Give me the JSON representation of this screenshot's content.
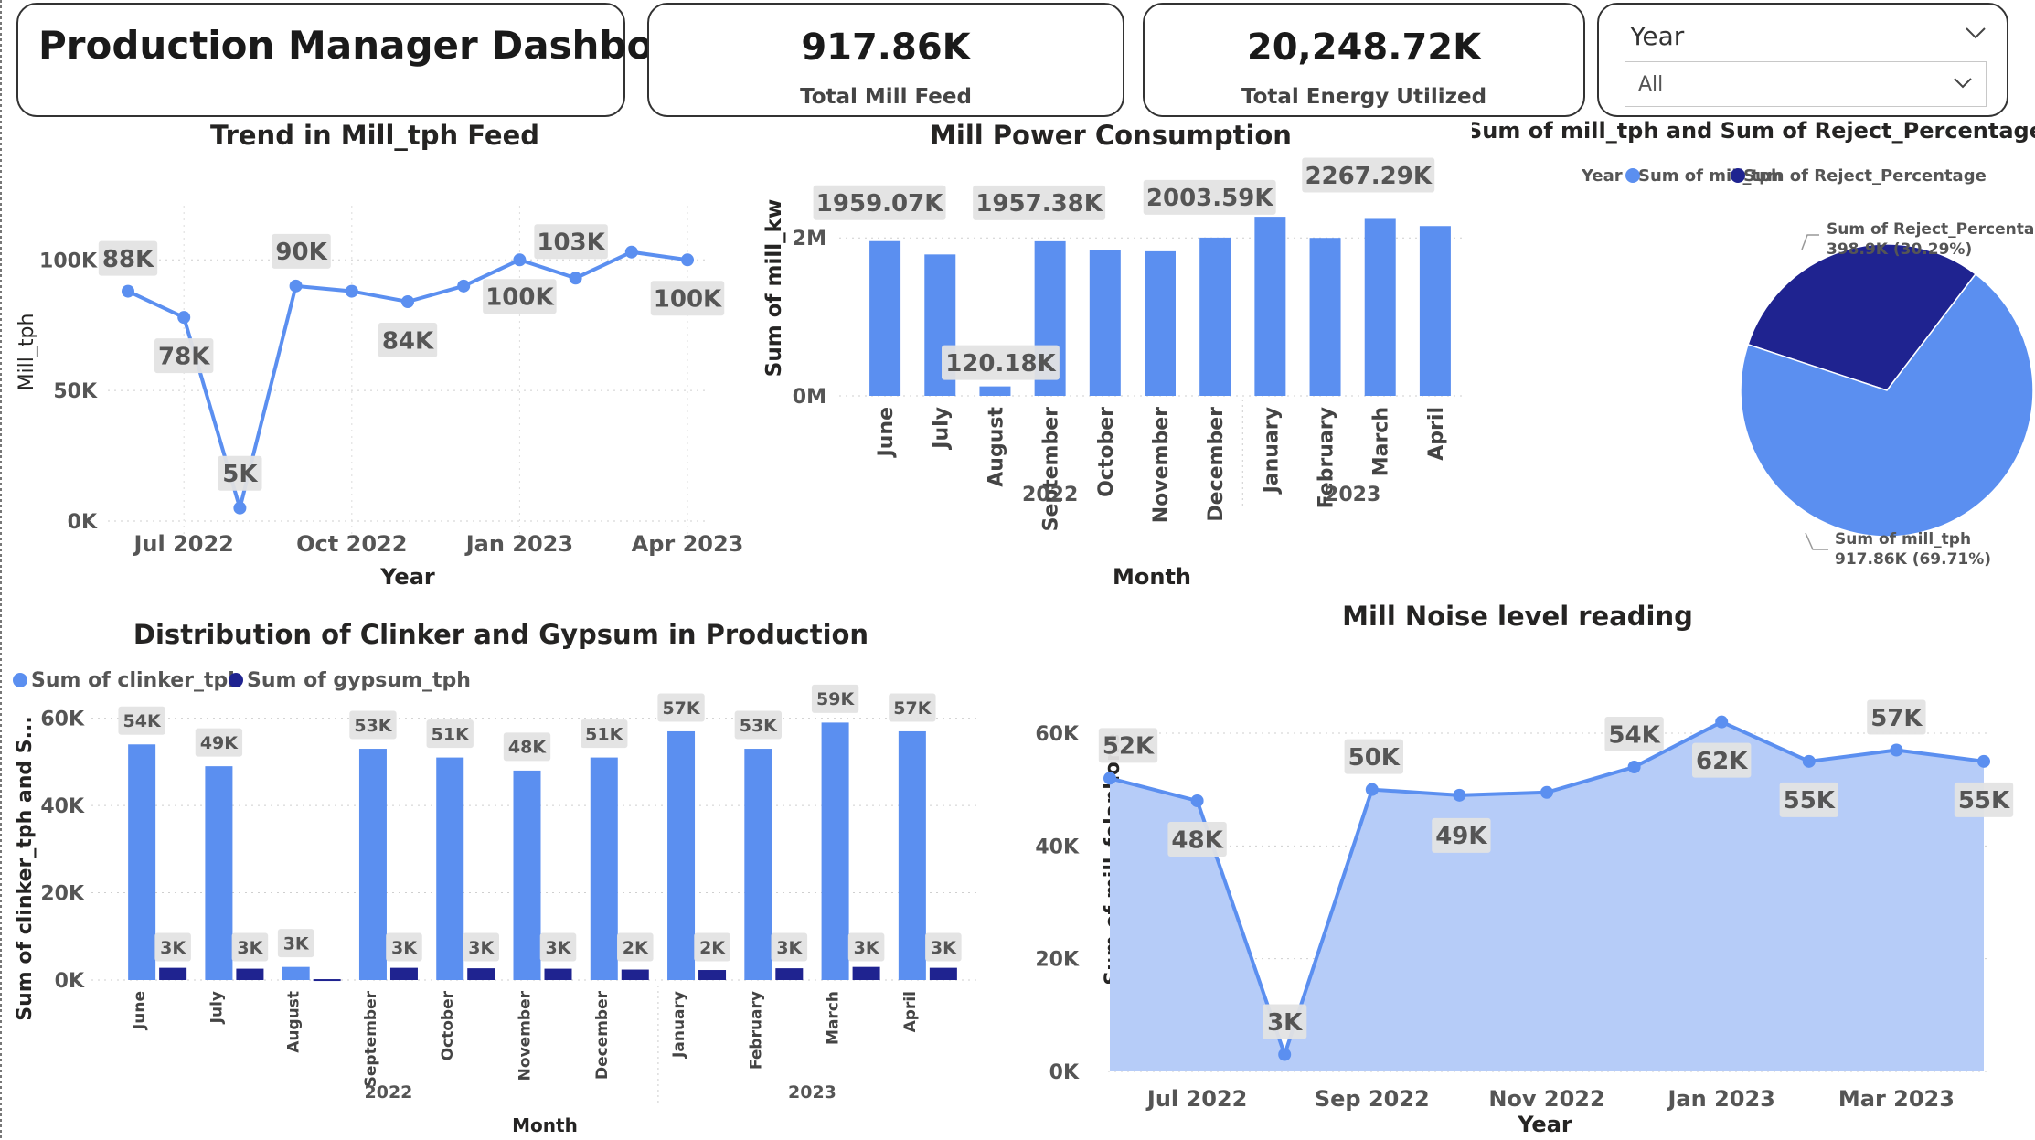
{
  "header": {
    "title": "Production Manager Dashboard",
    "kpis": [
      {
        "value": "917.86K",
        "label": "Total Mill Feed"
      },
      {
        "value": "20,248.72K",
        "label": "Total Energy Utilized"
      }
    ],
    "slicer": {
      "label": "Year",
      "selected": "All"
    }
  },
  "colors": {
    "primary": "#5b8ff0",
    "secondary": "#1f2390",
    "area": "#b6ccf8",
    "label_bg": "#e3e3e3"
  },
  "chart_data": [
    {
      "id": "trend",
      "type": "line",
      "title": "Trend in Mill_tph Feed",
      "xlabel": "Year",
      "ylabel": "Mill_tph",
      "x": [
        "2022-06",
        "2022-07",
        "2022-08",
        "2022-09",
        "2022-10",
        "2022-11",
        "2022-12",
        "2023-01",
        "2023-02",
        "2023-03",
        "2023-04"
      ],
      "values": [
        88,
        78,
        5,
        90,
        88,
        84,
        90,
        100,
        93,
        103,
        100
      ],
      "data_labels": [
        "88K",
        "78K",
        "5K",
        "90K",
        "",
        "84K",
        "",
        "100K",
        "103K",
        "",
        "100K"
      ],
      "x_ticks": [
        "Jul 2022",
        "Oct 2022",
        "Jan 2023",
        "Apr 2023"
      ],
      "y_ticks": [
        "0K",
        "50K",
        "100K"
      ],
      "ylim": [
        0,
        112
      ],
      "unit": "K"
    },
    {
      "id": "power",
      "type": "bar",
      "title": "Mill Power Consumption",
      "xlabel": "Month",
      "ylabel": "Sum of mill_kw",
      "categories": [
        "June",
        "July",
        "August",
        "September",
        "October",
        "November",
        "December",
        "January",
        "February",
        "March",
        "April"
      ],
      "values": [
        1959.07,
        1790,
        120.18,
        1957.38,
        1850,
        1830,
        2003.59,
        2267.29,
        2000,
        2240,
        2150
      ],
      "data_labels": [
        "1959.07K",
        "",
        "120.18K",
        "1957.38K",
        "",
        "",
        "2003.59K",
        "",
        "",
        "2267.29K",
        ""
      ],
      "groups": [
        {
          "label": "2022",
          "span": 7
        },
        {
          "label": "2023",
          "span": 4
        }
      ],
      "y_ticks": [
        "0M",
        "2M"
      ],
      "ylim": [
        0,
        2500
      ],
      "unit": "K"
    },
    {
      "id": "pie",
      "type": "pie",
      "title": "Sum of mill_tph and Sum of Reject_Percentage",
      "legend_title": "Year",
      "slices": [
        {
          "name": "Sum of mill_tph",
          "value": 917.86,
          "label": "917.86K (69.71%)"
        },
        {
          "name": "Sum of Reject_Percentage",
          "value": 398.9,
          "label": "398.9K (30.29%)"
        }
      ]
    },
    {
      "id": "clinker",
      "type": "bar",
      "title": "Distribution of Clinker and Gypsum in Production",
      "xlabel": "Month",
      "ylabel": "Sum of clinker_tph and S...",
      "categories": [
        "June",
        "July",
        "August",
        "September",
        "October",
        "November",
        "December",
        "January",
        "February",
        "March",
        "April"
      ],
      "groups": [
        {
          "label": "2022",
          "span": 7
        },
        {
          "label": "2023",
          "span": 4
        }
      ],
      "series": [
        {
          "name": "Sum of clinker_tph",
          "values": [
            54,
            49,
            3,
            53,
            51,
            48,
            51,
            57,
            53,
            59,
            57
          ],
          "labels": [
            "54K",
            "49K",
            "3K",
            "53K",
            "51K",
            "48K",
            "51K",
            "57K",
            "53K",
            "59K",
            "57K"
          ]
        },
        {
          "name": "Sum of gypsum_tph",
          "values": [
            2.8,
            2.6,
            0.2,
            2.8,
            2.7,
            2.6,
            2.4,
            2.3,
            2.7,
            3.0,
            2.8
          ],
          "labels": [
            "3K",
            "3K",
            "",
            "3K",
            "3K",
            "3K",
            "2K",
            "2K",
            "3K",
            "3K",
            "3K"
          ]
        }
      ],
      "y_ticks": [
        "0K",
        "20K",
        "40K",
        "60K"
      ],
      "ylim": [
        0,
        66
      ],
      "unit": "K"
    },
    {
      "id": "noise",
      "type": "area",
      "title": "Mill Noise level reading",
      "xlabel": "Year",
      "ylabel": "Sum of mill_folaphone",
      "x": [
        "2022-06",
        "2022-07",
        "2022-08",
        "2022-09",
        "2022-10",
        "2022-11",
        "2022-12",
        "2023-01",
        "2023-02",
        "2023-03",
        "2023-04"
      ],
      "values": [
        52,
        48,
        3,
        50,
        49,
        49.5,
        54,
        62,
        55,
        57,
        55
      ],
      "data_labels": [
        "52K",
        "48K",
        "3K",
        "50K",
        "49K",
        "",
        "54K",
        "62K",
        "55K",
        "57K",
        "55K"
      ],
      "x_ticks": [
        "Jul 2022",
        "Sep 2022",
        "Nov 2022",
        "Jan 2023",
        "Mar 2023"
      ],
      "y_ticks": [
        "0K",
        "20K",
        "40K",
        "60K"
      ],
      "ylim": [
        0,
        66
      ],
      "unit": "K"
    }
  ]
}
